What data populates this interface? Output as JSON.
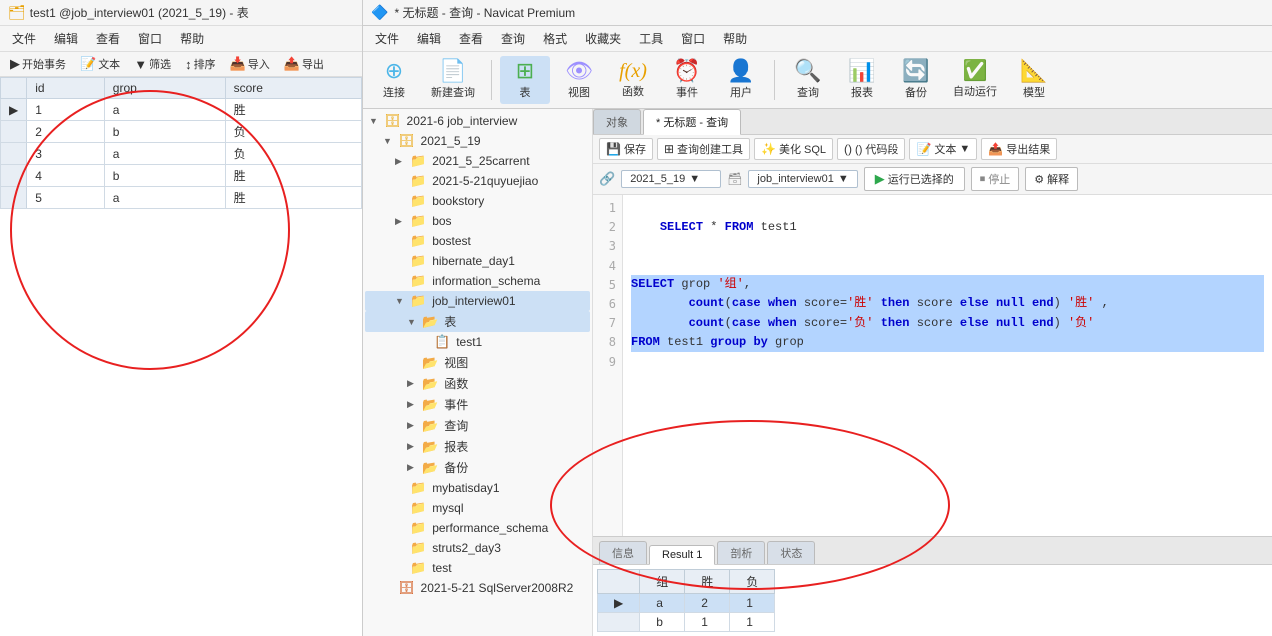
{
  "leftPanel": {
    "titleBar": "test1 @job_interview01 (2021_5_19) - 表",
    "menus": [
      "文件",
      "编辑",
      "查看",
      "窗口",
      "帮助"
    ],
    "toolbar": [
      "开始事务",
      "文本",
      "筛选",
      "排序",
      "导入",
      "导出"
    ],
    "columns": [
      "id",
      "grop",
      "score"
    ],
    "rows": [
      {
        "marker": "▶",
        "id": "1",
        "grop": "a",
        "score": "胜",
        "selected": false
      },
      {
        "marker": "",
        "id": "2",
        "grop": "b",
        "score": "负",
        "selected": false
      },
      {
        "marker": "",
        "id": "3",
        "grop": "a",
        "score": "负",
        "selected": false
      },
      {
        "marker": "",
        "id": "4",
        "grop": "b",
        "score": "胜",
        "selected": false
      },
      {
        "marker": "",
        "id": "5",
        "grop": "a",
        "score": "胜",
        "selected": false
      }
    ]
  },
  "rightPanel": {
    "titleBar": "* 无标题 - 查询 - Navicat Premium",
    "menus": [
      "文件",
      "编辑",
      "查看",
      "查询",
      "格式",
      "收藏夹",
      "工具",
      "窗口",
      "帮助"
    ],
    "bigToolbar": {
      "buttons": [
        {
          "label": "连接",
          "icon": "🔌"
        },
        {
          "label": "新建查询",
          "icon": "📄"
        },
        {
          "label": "表",
          "icon": "📋"
        },
        {
          "label": "视图",
          "icon": "👁"
        },
        {
          "label": "函数",
          "icon": "𝑓"
        },
        {
          "label": "事件",
          "icon": "⏰"
        },
        {
          "label": "用户",
          "icon": "👤"
        },
        {
          "label": "查询",
          "icon": "🔍"
        },
        {
          "label": "报表",
          "icon": "📊"
        },
        {
          "label": "备份",
          "icon": "🔄"
        },
        {
          "label": "自动运行",
          "icon": "▶"
        },
        {
          "label": "模型",
          "icon": "📐"
        }
      ]
    },
    "tabs": {
      "object": "对象",
      "query": "* 无标题 - 查询"
    },
    "editorToolbar": {
      "save": "保存",
      "queryBuilder": "查询创建工具",
      "beautifySQL": "美化 SQL",
      "codeSnippet": "() 代码段",
      "text": "文本",
      "exportResult": "导出结果"
    },
    "dbSelector": {
      "db1": "2021_5_19",
      "db2": "job_interview01",
      "runSelected": "运行已选择的",
      "stop": "停止",
      "explain": "解释"
    },
    "codeLines": [
      {
        "num": "1",
        "text": "",
        "highlight": false
      },
      {
        "num": "2",
        "text": "    SELECT * FROM test1",
        "highlight": false
      },
      {
        "num": "3",
        "text": "",
        "highlight": false
      },
      {
        "num": "4",
        "text": "",
        "highlight": false
      },
      {
        "num": "5",
        "text": "SELECT grop '组',",
        "highlight": true
      },
      {
        "num": "6",
        "text": "        count(case when score='胜' then score else null end) '胜' ,",
        "highlight": true
      },
      {
        "num": "7",
        "text": "        count(case when score='负' then score else null end) '负'",
        "highlight": true
      },
      {
        "num": "8",
        "text": "FROM test1 group by grop",
        "highlight": true
      },
      {
        "num": "9",
        "text": "",
        "highlight": false
      }
    ],
    "resultTabs": [
      "信息",
      "Result 1",
      "剖析",
      "状态"
    ],
    "resultActiveTab": "Result 1",
    "resultColumns": [
      "组",
      "胜",
      "负"
    ],
    "resultRows": [
      {
        "marker": "▶",
        "group": "a",
        "win": "2",
        "lose": "1",
        "selected": true
      },
      {
        "marker": "",
        "group": "b",
        "win": "1",
        "lose": "1",
        "selected": false
      }
    ]
  },
  "sidebar": {
    "items": [
      {
        "level": 0,
        "expand": "▼",
        "icon": "db",
        "label": "2021-6 job_interview"
      },
      {
        "level": 1,
        "expand": "▼",
        "icon": "db",
        "label": "2021_5_19"
      },
      {
        "level": 2,
        "expand": "▶",
        "icon": "folder",
        "label": "2021_5_25carrent"
      },
      {
        "level": 2,
        "expand": "",
        "icon": "folder",
        "label": "2021-5-21quyuejiao"
      },
      {
        "level": 2,
        "expand": "",
        "icon": "folder",
        "label": "bookstory"
      },
      {
        "level": 2,
        "expand": "▶",
        "icon": "folder",
        "label": "bos"
      },
      {
        "level": 2,
        "expand": "",
        "icon": "folder",
        "label": "bostest"
      },
      {
        "level": 2,
        "expand": "",
        "icon": "folder",
        "label": "hibernate_day1"
      },
      {
        "level": 2,
        "expand": "",
        "icon": "folder",
        "label": "information_schema"
      },
      {
        "level": 2,
        "expand": "▼",
        "icon": "folder",
        "label": "job_interview01"
      },
      {
        "level": 3,
        "expand": "▼",
        "icon": "table-folder",
        "label": "表"
      },
      {
        "level": 4,
        "expand": "",
        "icon": "table",
        "label": "test1"
      },
      {
        "level": 3,
        "expand": "",
        "icon": "view-folder",
        "label": "视图"
      },
      {
        "level": 3,
        "expand": "▶",
        "icon": "func-folder",
        "label": "函数"
      },
      {
        "level": 3,
        "expand": "▶",
        "icon": "event-folder",
        "label": "事件"
      },
      {
        "level": 3,
        "expand": "▶",
        "icon": "query-folder",
        "label": "查询"
      },
      {
        "level": 3,
        "expand": "▶",
        "icon": "report-folder",
        "label": "报表"
      },
      {
        "level": 3,
        "expand": "▶",
        "icon": "backup-folder",
        "label": "备份"
      },
      {
        "level": 2,
        "expand": "",
        "icon": "folder",
        "label": "mybatisday1"
      },
      {
        "level": 2,
        "expand": "",
        "icon": "folder",
        "label": "mysql"
      },
      {
        "level": 2,
        "expand": "",
        "icon": "folder",
        "label": "performance_schema"
      },
      {
        "level": 2,
        "expand": "",
        "icon": "folder",
        "label": "struts2_day3"
      },
      {
        "level": 2,
        "expand": "",
        "icon": "folder",
        "label": "test"
      },
      {
        "level": 1,
        "expand": "",
        "icon": "sqlserver",
        "label": "2021-5-21 SqlServer2008R2"
      }
    ]
  }
}
